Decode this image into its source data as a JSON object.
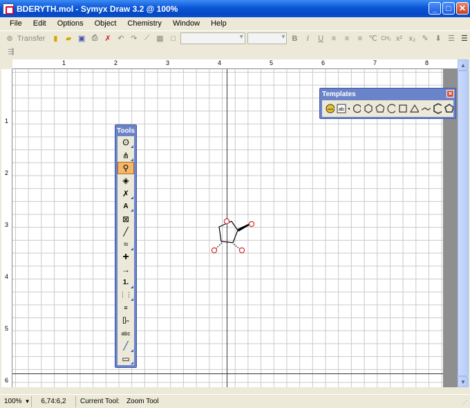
{
  "window": {
    "title": "BDERYTH.mol - Symyx Draw 3.2  @ 100%",
    "minimize_icon": "minimize-icon",
    "maximize_icon": "maximize-icon",
    "close_icon": "close-icon"
  },
  "menu": {
    "items": [
      {
        "label": "File"
      },
      {
        "label": "Edit"
      },
      {
        "label": "Options"
      },
      {
        "label": "Object"
      },
      {
        "label": "Chemistry"
      },
      {
        "label": "Window"
      },
      {
        "label": "Help"
      }
    ]
  },
  "toolbar": {
    "transfer_label": "Transfer",
    "font_combo_value": "",
    "size_combo_value": "",
    "bold": "B",
    "italic": "I",
    "underline": "U"
  },
  "ruler": {
    "h_labels": [
      "1",
      "2",
      "3",
      "4",
      "5",
      "6",
      "7",
      "8"
    ],
    "v_labels": [
      "1",
      "2",
      "3",
      "4",
      "5",
      "6"
    ]
  },
  "tools_palette": {
    "title": "Tools",
    "tools": [
      {
        "name": "lasso-tool",
        "glyph": "ʘ"
      },
      {
        "name": "select-tool",
        "glyph": "⋔"
      },
      {
        "name": "zoom-tool",
        "glyph": "🔍"
      },
      {
        "name": "eraser-tool",
        "glyph": "◈"
      },
      {
        "name": "atom-tool",
        "glyph": "✗"
      },
      {
        "name": "text-atom-tool",
        "glyph": "A"
      },
      {
        "name": "template-tool",
        "glyph": "⊠"
      },
      {
        "name": "bond-tool",
        "glyph": "╱"
      },
      {
        "name": "chain-tool",
        "glyph": "≈"
      },
      {
        "name": "plus-tool",
        "glyph": "+"
      },
      {
        "name": "arrow-tool",
        "glyph": "→"
      },
      {
        "name": "charge-tool",
        "glyph": "1."
      },
      {
        "name": "atom-map-tool",
        "glyph": "⋮"
      },
      {
        "name": "label-tool",
        "glyph": "≡"
      },
      {
        "name": "bracket-tool",
        "glyph": "[]"
      },
      {
        "name": "text-tool",
        "glyph": "abc"
      },
      {
        "name": "line-tool",
        "glyph": "╱"
      },
      {
        "name": "rectangle-tool",
        "glyph": "▭"
      }
    ],
    "selected": "zoom-tool"
  },
  "templates_palette": {
    "title": "Templates"
  },
  "status": {
    "zoom": "100%",
    "coords": "6,74:6,2",
    "current_tool_label": "Current Tool:",
    "current_tool_value": "Zoom Tool"
  }
}
